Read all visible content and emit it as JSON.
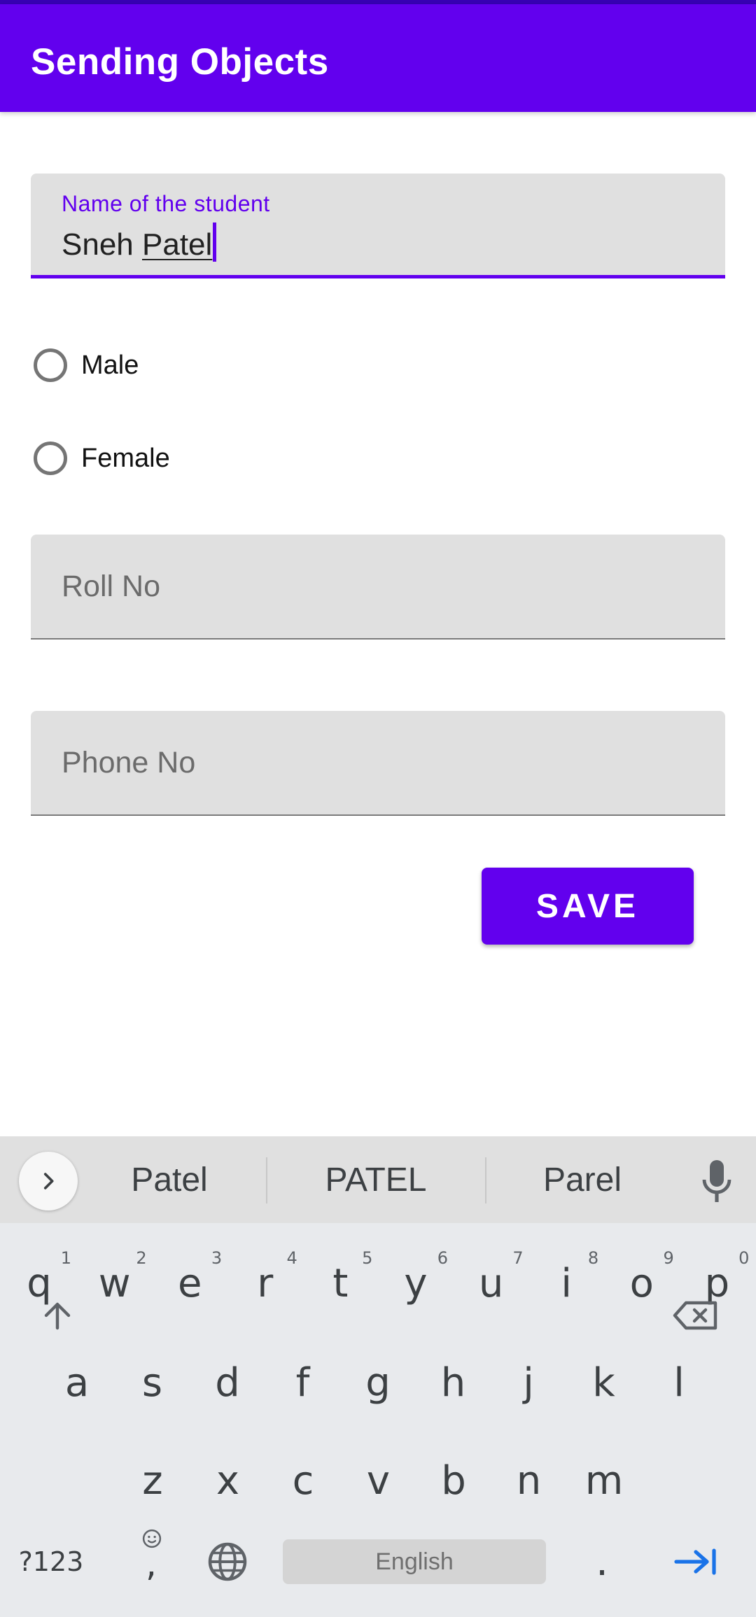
{
  "app_bar": {
    "title": "Sending Objects"
  },
  "name_field": {
    "label": "Name of the student",
    "first": "Sneh",
    "second": "Patel"
  },
  "gender": {
    "options": [
      "Male",
      "Female"
    ]
  },
  "roll_field": {
    "placeholder": "Roll No"
  },
  "phone_field": {
    "placeholder": "Phone No"
  },
  "save_button": {
    "label": "SAVE"
  },
  "colors": {
    "primary": "#6200ee",
    "primary_dark": "#3700b3",
    "field_bg": "#e0e0e0",
    "keyboard_bg": "#e8eaed",
    "action_blue": "#1a73e8"
  },
  "keyboard": {
    "suggestions": [
      "Patel",
      "PATEL",
      "Parel"
    ],
    "row1": [
      {
        "k": "q",
        "h": "1"
      },
      {
        "k": "w",
        "h": "2"
      },
      {
        "k": "e",
        "h": "3"
      },
      {
        "k": "r",
        "h": "4"
      },
      {
        "k": "t",
        "h": "5"
      },
      {
        "k": "y",
        "h": "6"
      },
      {
        "k": "u",
        "h": "7"
      },
      {
        "k": "i",
        "h": "8"
      },
      {
        "k": "o",
        "h": "9"
      },
      {
        "k": "p",
        "h": "0"
      }
    ],
    "row2": [
      "a",
      "s",
      "d",
      "f",
      "g",
      "h",
      "j",
      "k",
      "l"
    ],
    "row3": [
      "z",
      "x",
      "c",
      "v",
      "b",
      "n",
      "m"
    ],
    "symbols_label": "?123",
    "comma_label": ",",
    "space_label": "English",
    "period_label": ".",
    "icons": [
      "chevron-right-icon",
      "mic-icon",
      "shift-icon",
      "backspace-icon",
      "emoji-icon",
      "globe-icon",
      "tab-next-icon"
    ]
  }
}
